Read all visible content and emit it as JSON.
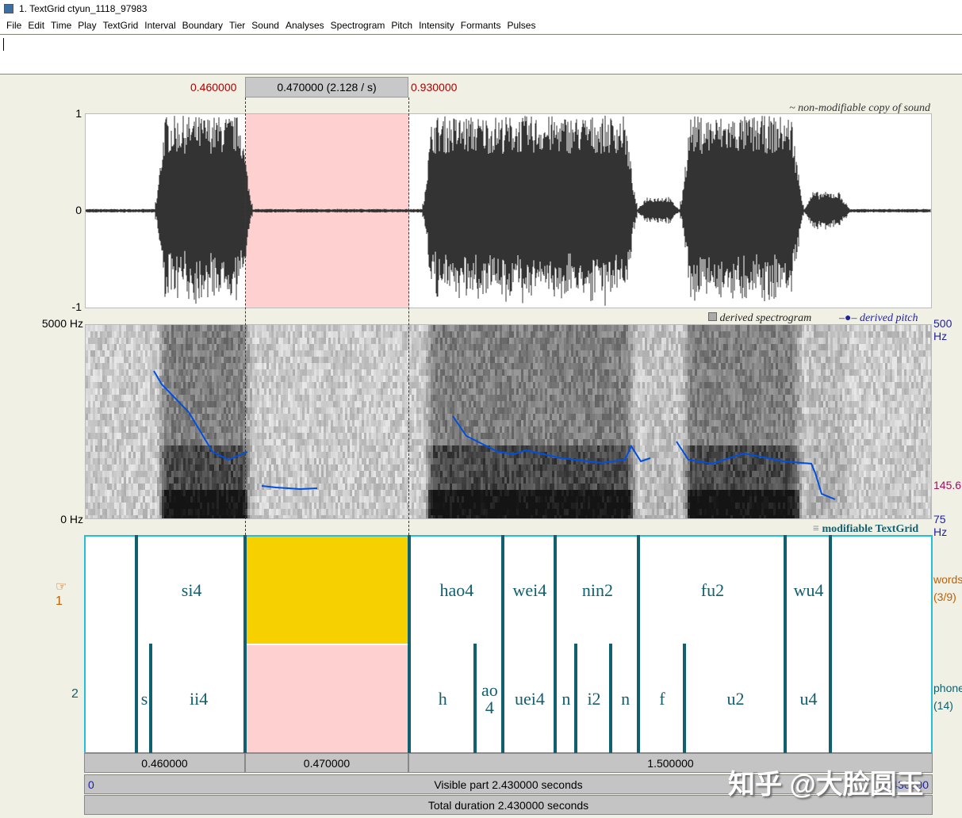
{
  "window": {
    "title": "1. TextGrid ctyun_1118_97983"
  },
  "menu": [
    "File",
    "Edit",
    "Time",
    "Play",
    "TextGrid",
    "Interval",
    "Boundary",
    "Tier",
    "Sound",
    "Analyses",
    "Spectrogram",
    "Pitch",
    "Intensity",
    "Formants",
    "Pulses"
  ],
  "selection": {
    "start": "0.460000",
    "end": "0.930000",
    "duration_label": "0.470000 (2.128 / s)"
  },
  "waveform": {
    "caption": "~ non-modifiable copy of sound",
    "y_top": "1",
    "y_mid": "0",
    "y_bottom": "-1"
  },
  "spectrogram": {
    "top_label": "5000 Hz",
    "bottom_label": "0 Hz",
    "legend_spec": "derived spectrogram",
    "legend_pitch": "derived pitch",
    "pitch_top": "500 Hz",
    "pitch_mid": "145.6",
    "pitch_bottom": "75 Hz"
  },
  "textgrid": {
    "caption": "modifiable TextGrid",
    "tiers": [
      {
        "number": "1",
        "name": "words",
        "info": "(3/9)",
        "selected_interval": 2,
        "intervals": [
          {
            "text": "",
            "start": 0,
            "end": 0.148
          },
          {
            "text": "si4",
            "start": 0.148,
            "end": 0.46
          },
          {
            "text": "",
            "start": 0.46,
            "end": 0.93
          },
          {
            "text": "hao4",
            "start": 0.93,
            "end": 1.199
          },
          {
            "text": "wei4",
            "start": 1.199,
            "end": 1.349
          },
          {
            "text": "nin2",
            "start": 1.349,
            "end": 1.588
          },
          {
            "text": "fu2",
            "start": 1.588,
            "end": 2.009
          },
          {
            "text": "wu4",
            "start": 2.009,
            "end": 2.139
          },
          {
            "text": "",
            "start": 2.139,
            "end": 2.43
          }
        ]
      },
      {
        "number": "2",
        "name": "phone",
        "info": "(14)",
        "intervals": [
          {
            "text": "",
            "start": 0,
            "end": 0.148
          },
          {
            "text": "s",
            "start": 0.148,
            "end": 0.189
          },
          {
            "text": "ii4",
            "start": 0.189,
            "end": 0.46
          },
          {
            "text": "",
            "start": 0.46,
            "end": 0.93
          },
          {
            "text": "h",
            "start": 0.93,
            "end": 1.119
          },
          {
            "text": "ao\n4",
            "start": 1.119,
            "end": 1.199
          },
          {
            "text": "uei4",
            "start": 1.199,
            "end": 1.349
          },
          {
            "text": "n",
            "start": 1.349,
            "end": 1.408
          },
          {
            "text": "i2",
            "start": 1.408,
            "end": 1.509
          },
          {
            "text": "n",
            "start": 1.509,
            "end": 1.588
          },
          {
            "text": "f",
            "start": 1.588,
            "end": 1.72
          },
          {
            "text": "u2",
            "start": 1.72,
            "end": 2.009
          },
          {
            "text": "u4",
            "start": 2.009,
            "end": 2.139
          },
          {
            "text": "",
            "start": 2.139,
            "end": 2.43
          }
        ]
      }
    ]
  },
  "bottom": {
    "seg1": "0.460000",
    "seg2": "0.470000",
    "seg3": "1.500000",
    "vis_start": "0",
    "vis_end": "2.430000",
    "visible": "Visible part 2.430000 seconds",
    "total": "Total duration 2.430000 seconds"
  },
  "watermark": "知乎 @大脸圆玉",
  "colors": {
    "selection": "#ffd0d0",
    "selected_interval": "#f7d000",
    "boundary": "#106070",
    "pitch": "#0050e0"
  }
}
